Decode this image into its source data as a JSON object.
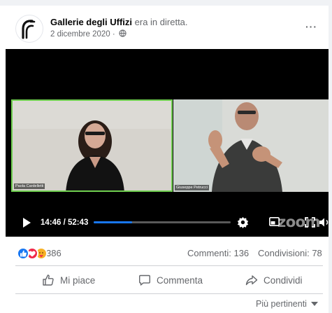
{
  "post": {
    "page_name": "Gallerie degli Uffizi",
    "verb": " era in diretta.",
    "date": "2 dicembre 2020 ·",
    "more_label": "···"
  },
  "video": {
    "participants": [
      {
        "label": "Paola Cardelletti"
      },
      {
        "label": "Giuseppe Petrucci"
      }
    ],
    "time_display": "14:46 / 52:43",
    "progress_fraction": 0.28,
    "watermark": "zoom"
  },
  "stats": {
    "reaction_count": "386",
    "comments": "Commenti: 136",
    "shares": "Condivisioni: 78"
  },
  "actions": {
    "like_label": "Mi piace",
    "comment_label": "Commenta",
    "share_label": "Condividi"
  },
  "sort": {
    "label": "Più pertinenti"
  },
  "colors": {
    "accent": "#1877f2",
    "love": "#f02849",
    "care": "#f7b125",
    "active_speaker": "#6fcf4f"
  },
  "icons": [
    "uffizi-logo-icon",
    "globe-icon",
    "more-icon",
    "play-icon",
    "gear-icon",
    "pip-icon",
    "expand-icon",
    "volume-icon",
    "like-reaction-icon",
    "love-reaction-icon",
    "care-reaction-icon",
    "thumbs-up-icon",
    "comment-icon",
    "share-icon",
    "chevron-down-icon"
  ]
}
